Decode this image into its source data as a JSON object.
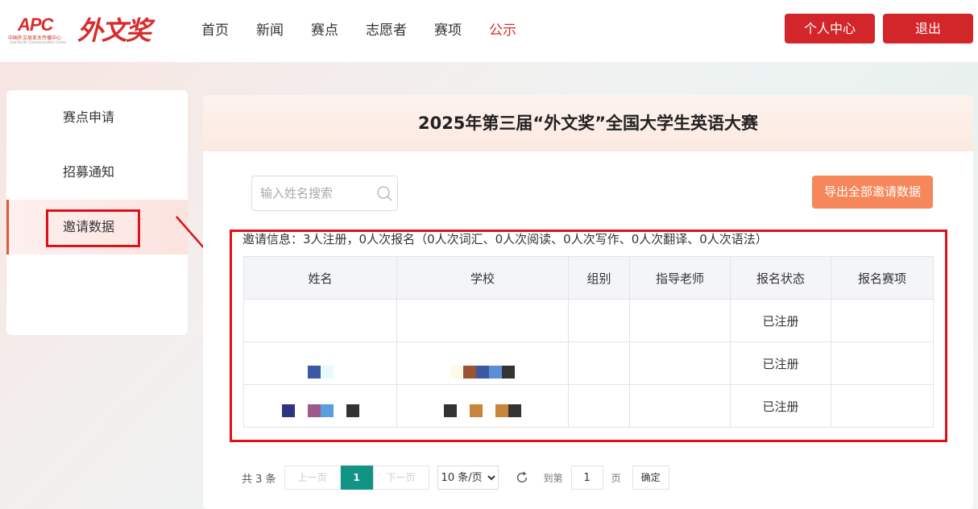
{
  "header": {
    "logo_text": "APC",
    "logo_sub": "中国外文局亚太传播中心",
    "logo_sub_en": "Asia-Pacific Communication Center",
    "award_logo": "外文奖",
    "nav": [
      "首页",
      "新闻",
      "赛点",
      "志愿者",
      "赛项",
      "公示"
    ],
    "active_nav": "公示",
    "profile_button": "个人中心",
    "logout_button": "退出"
  },
  "sidebar": {
    "items": [
      "赛点申请",
      "招募通知",
      "邀请数据"
    ],
    "active": "邀请数据"
  },
  "main": {
    "title": "2025年第三届“外文奖”全国大学生英语大赛",
    "search_placeholder": "输入姓名搜索",
    "export_button": "导出全部邀请数据",
    "invite_info": "邀请信息：3人注册，0人次报名（0人次词汇、0人次阅读、0人次写作、0人次翻译、0人次语法）",
    "table": {
      "headers": [
        "姓名",
        "学校",
        "组别",
        "指导老师",
        "报名状态",
        "报名赛项"
      ],
      "rows": [
        {
          "name": "",
          "school": "",
          "group": "",
          "teacher": "",
          "status": "已注册",
          "event": ""
        },
        {
          "name": "",
          "school": "",
          "group": "",
          "teacher": "",
          "status": "已注册",
          "event": ""
        },
        {
          "name": "",
          "school": "",
          "group": "",
          "teacher": "",
          "status": "已注册",
          "event": ""
        }
      ]
    }
  },
  "pager": {
    "total": "共 3 条",
    "prev": "上一页",
    "current": "1",
    "next": "下一页",
    "page_size": "10 条/页",
    "goto_label": "到第",
    "goto_value": "1",
    "page_label": "页",
    "confirm": "确定"
  },
  "colors": {
    "brand_red": "#d2262a",
    "export_orange": "#f5875a",
    "pager_active": "#119484",
    "annotation_red": "#e0101a"
  }
}
